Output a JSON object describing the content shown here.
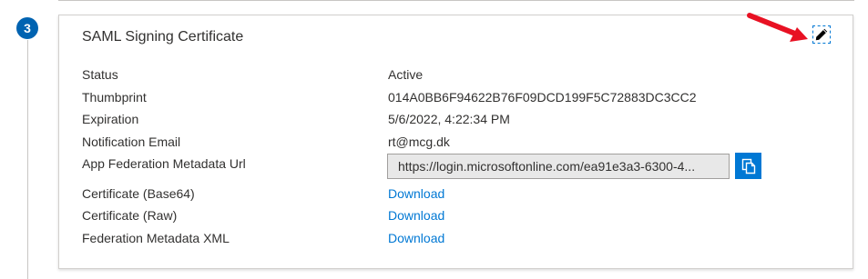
{
  "step": {
    "number": "3"
  },
  "card": {
    "title": "SAML Signing Certificate",
    "edit_icon": "pencil-icon",
    "arrow_color": "#e81123"
  },
  "fields": {
    "status": {
      "label": "Status",
      "value": "Active"
    },
    "thumbprint": {
      "label": "Thumbprint",
      "value": "014A0BB6F94622B76F09DCD199F5C72883DC3CC2"
    },
    "expiration": {
      "label": "Expiration",
      "value": "5/6/2022, 4:22:34 PM"
    },
    "notification_email": {
      "label": "Notification Email",
      "value": "rt@mcg.dk"
    },
    "metadata_url": {
      "label": "App Federation Metadata Url",
      "value": "https://login.microsoftonline.com/ea91e3a3-6300-4...",
      "copy_icon": "copy-icon"
    },
    "cert_base64": {
      "label": "Certificate (Base64)",
      "link": "Download"
    },
    "cert_raw": {
      "label": "Certificate (Raw)",
      "link": "Download"
    },
    "federation_xml": {
      "label": "Federation Metadata XML",
      "link": "Download"
    }
  },
  "colors": {
    "accent": "#0078d4",
    "step_badge": "#0063b1",
    "text": "#323130",
    "border": "#d2d0ce"
  }
}
